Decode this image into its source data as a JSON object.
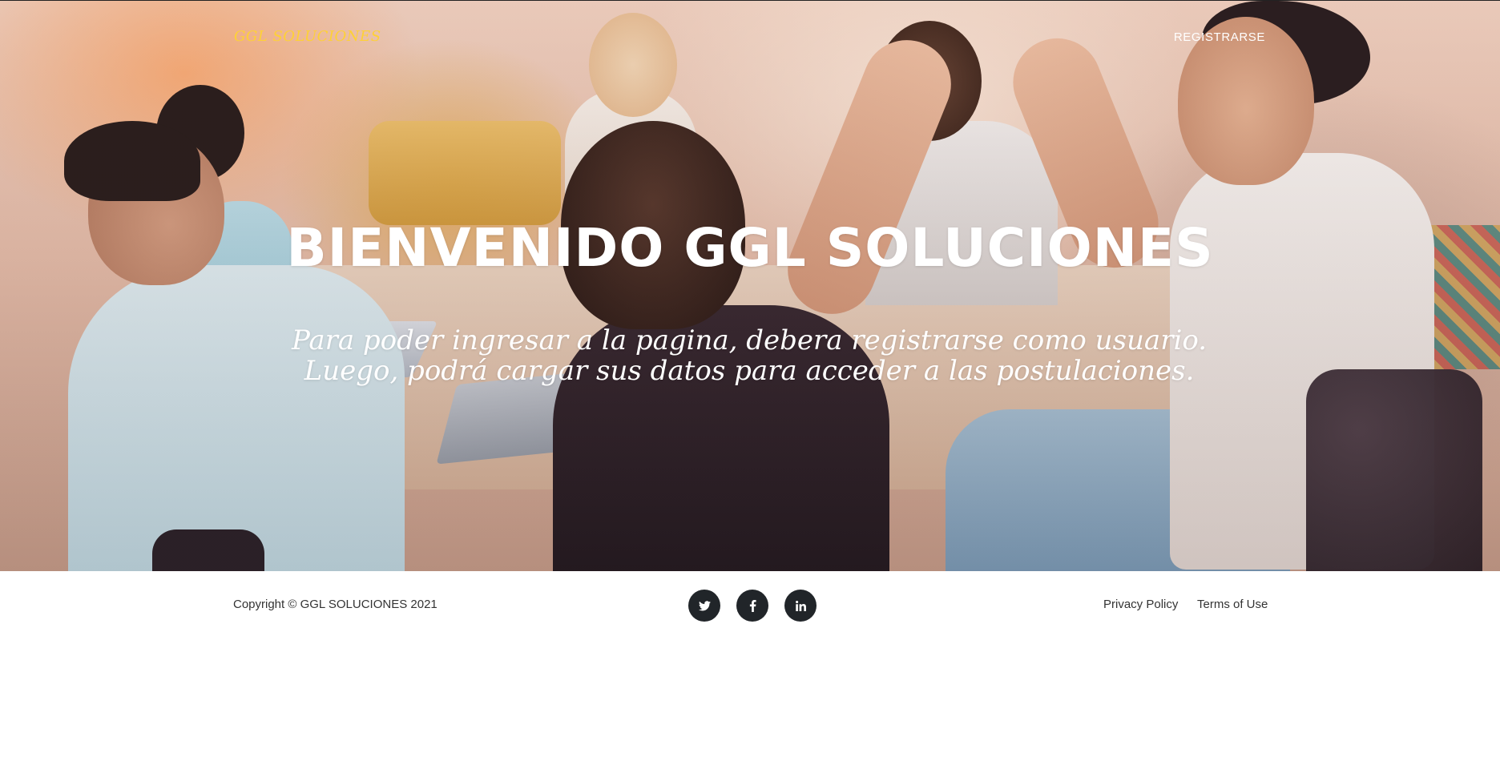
{
  "navbar": {
    "brand": "GGL SOLUCIONES",
    "register_link": "REGISTRARSE"
  },
  "hero": {
    "heading": "BIENVENIDO GGL SOLUCIONES",
    "subheading": "Para poder ingresar a la pagina, debera registrarse como usuario. Luego, podrá cargar sus datos para acceder a las postulaciones."
  },
  "footer": {
    "copyright": "Copyright © GGL SOLUCIONES 2021",
    "social": [
      {
        "icon": "twitter-icon"
      },
      {
        "icon": "facebook-icon"
      },
      {
        "icon": "linkedin-icon"
      }
    ],
    "links": {
      "privacy": "Privacy Policy",
      "terms": "Terms of Use"
    }
  },
  "colors": {
    "brand": "#fed136",
    "social_bg": "#212529",
    "footer_text": "#333333"
  }
}
